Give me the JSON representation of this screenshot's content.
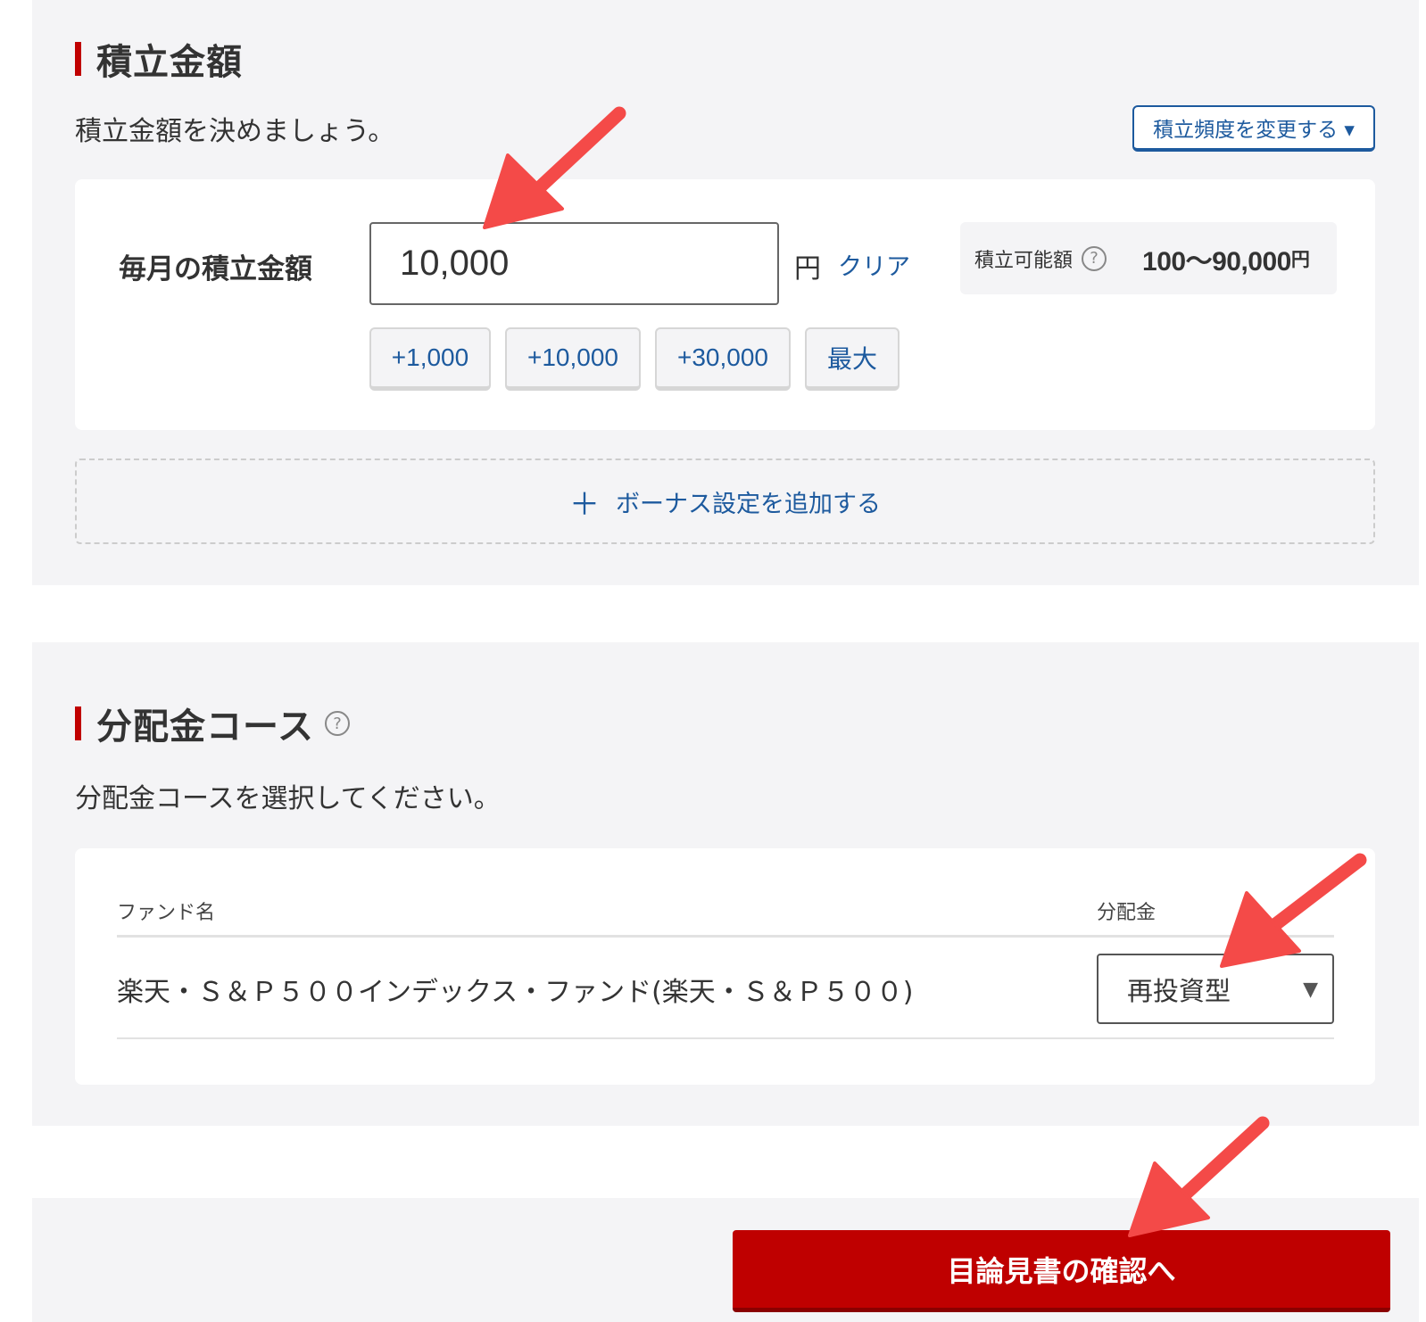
{
  "amount_section": {
    "heading": "積立金額",
    "lead": "積立金額を決めましょう。",
    "frequency_button": "積立頻度を変更する ▾",
    "monthly_label": "毎月の積立金額",
    "amount_value": "10,000",
    "unit": "円",
    "clear_link": "クリア",
    "limit": {
      "label": "積立可能額",
      "range": "100〜90,000",
      "unit": "円"
    },
    "quick_buttons": [
      "+1,000",
      "+10,000",
      "+30,000",
      "最大"
    ],
    "bonus_plus": "＋",
    "bonus_text": "ボーナス設定を追加する"
  },
  "distribution_section": {
    "heading": "分配金コース",
    "lead": "分配金コースを選択してください。",
    "table": {
      "col_fund": "ファンド名",
      "col_dist": "分配金",
      "rows": [
        {
          "fund": "楽天・Ｓ＆Ｐ５００インデックス・ファンド(楽天・Ｓ＆Ｐ５００)",
          "selected": "再投資型"
        }
      ]
    }
  },
  "footer": {
    "confirm_button": "目論見書の確認へ"
  },
  "icons": {
    "help": "?",
    "dropdown": "▼"
  },
  "colors": {
    "accent_red": "#c00000",
    "link_blue": "#1d5a9e",
    "panel_bg": "#f4f4f6",
    "annotation_arrow": "#f44a48"
  }
}
